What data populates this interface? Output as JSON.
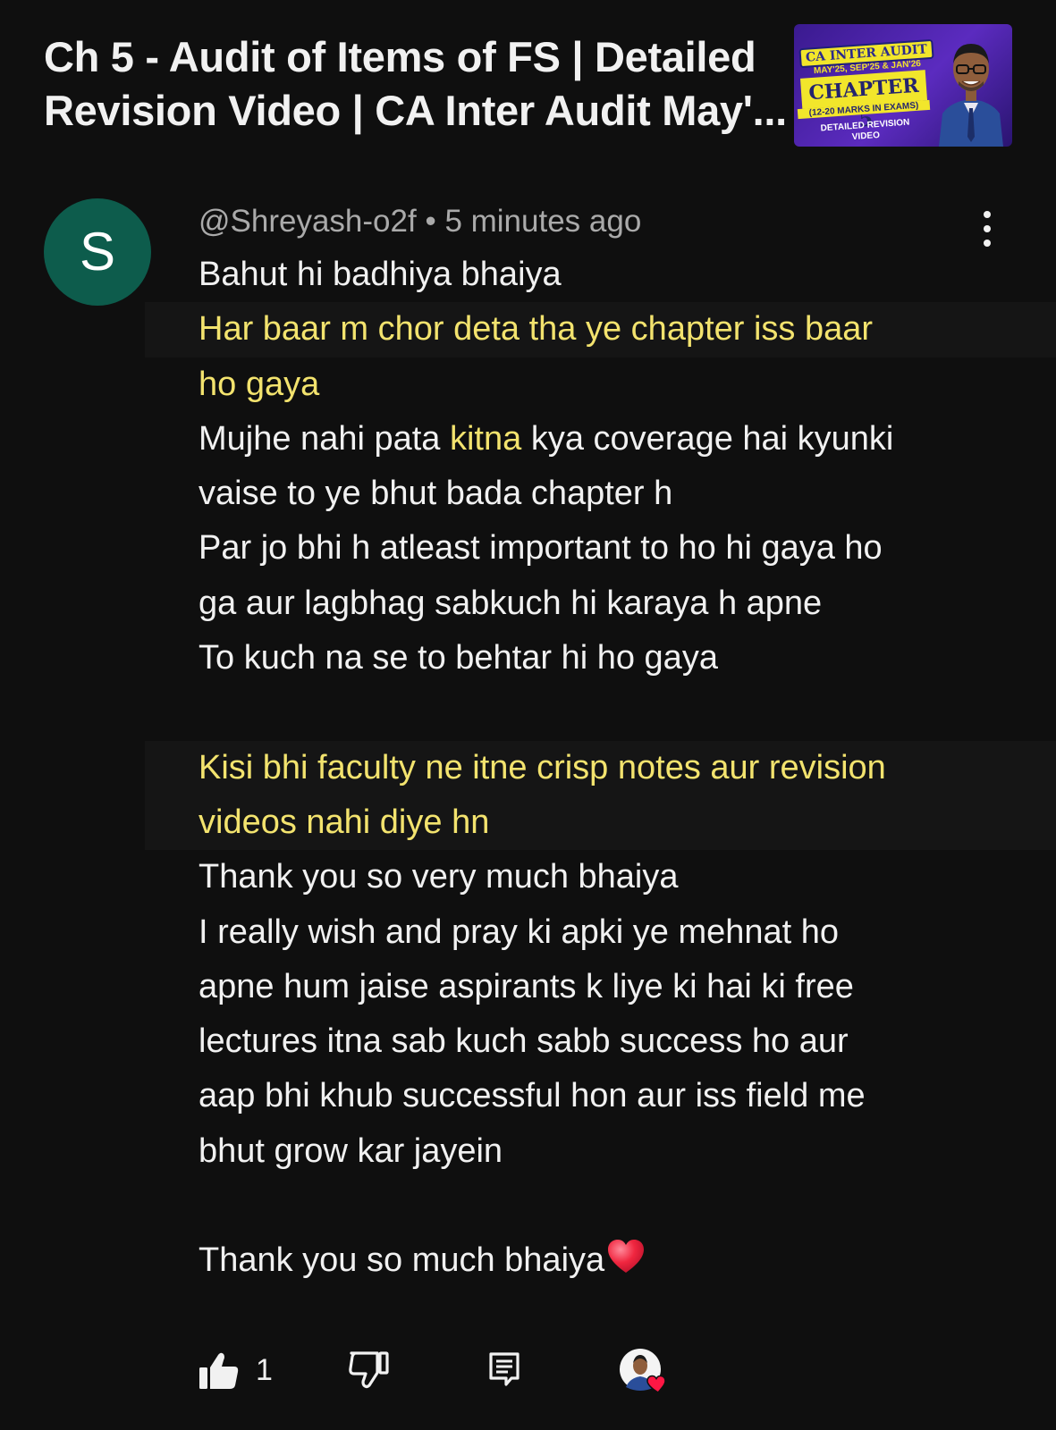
{
  "header": {
    "video_title_line1": "Ch 5 - Audit of Items of FS | Detailed",
    "video_title_line2": "Revision Video | CA Inter Audit May'...",
    "thumbnail": {
      "badge": "CA INTER AUDIT",
      "dates": "MAY'25, SEP'25 & JAN'26",
      "chapter": "CHAPTER 5",
      "marks": "(12-20 MARKS IN EXAMS)",
      "detail": "DETAILED REVISION VIDEO"
    }
  },
  "comment": {
    "avatar_letter": "S",
    "author": "@Shreyash-o2f",
    "separator": "•",
    "time": "5 minutes ago",
    "lines": {
      "l1": "Bahut hi badhiya bhaiya",
      "l2": "Har baar m chor deta tha ye chapter iss baar",
      "l3": "ho gaya",
      "l4a": "Mujhe nahi pata ",
      "l4b": "kitna",
      "l4c": " kya coverage hai kyunki",
      "l5": "vaise to ye bhut bada chapter h",
      "l6": "Par jo bhi h atleast important to ho hi gaya ho",
      "l7": "ga aur lagbhag sabkuch hi karaya h apne",
      "l8": "To kuch na se to behtar hi ho gaya",
      "l9": "Kisi bhi faculty ne itne crisp notes aur revision",
      "l10": "videos nahi diye hn",
      "l11": "Thank you so very much bhaiya",
      "l12": "I really wish and pray ki apki ye mehnat ho",
      "l13": "apne hum jaise aspirants k liye ki hai ki free",
      "l14": "lectures itna sab kuch sabb success ho aur",
      "l15": "aap bhi khub successful hon aur iss field me",
      "l16": "bhut grow kar jayein",
      "l17": "Thank you so much bhaiya"
    }
  },
  "actions": {
    "like_count": "1"
  },
  "colors": {
    "background": "#0f0f0f",
    "text": "#f1f1f1",
    "secondary_text": "#aaaaaa",
    "highlight_text": "#f3e36e",
    "avatar_bg": "#0d5c4c",
    "heart": "#ff1744"
  },
  "icons": [
    "thumbs-up-icon",
    "thumbs-down-icon",
    "reply-icon",
    "more-vert-icon",
    "heart-emoji",
    "creator-heart-avatar"
  ]
}
